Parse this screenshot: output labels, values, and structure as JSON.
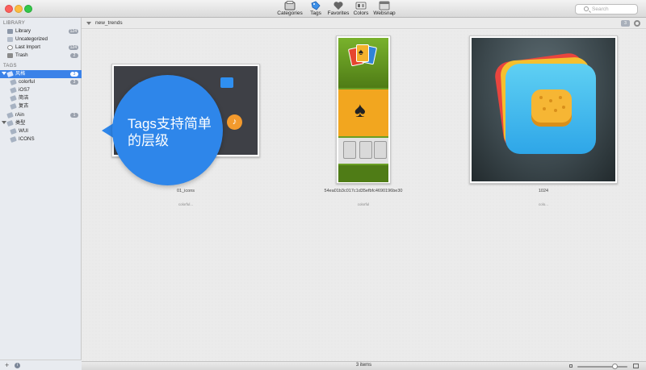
{
  "toolbar": {
    "buttons": [
      {
        "label": "Categories",
        "icon": "categories-icon"
      },
      {
        "label": "Tags",
        "icon": "tag-icon"
      },
      {
        "label": "Favorites",
        "icon": "heart-icon"
      },
      {
        "label": "Colors",
        "icon": "colors-icon"
      },
      {
        "label": "Websnap",
        "icon": "websnap-icon"
      }
    ],
    "search_placeholder": "Search"
  },
  "sidebar": {
    "library_header": "LIBRARY",
    "library_items": [
      {
        "label": "Library",
        "count": "124"
      },
      {
        "label": "Uncategorized",
        "count": ""
      },
      {
        "label": "Last Import",
        "count": "124"
      },
      {
        "label": "Trash",
        "count": "2"
      }
    ],
    "tags_header": "TAGS",
    "tag_items": [
      {
        "label": "风格",
        "count": "3"
      },
      {
        "label": "colorful",
        "count": "3"
      },
      {
        "label": "iOS7",
        "count": ""
      },
      {
        "label": "简洁",
        "count": ""
      },
      {
        "label": "复古",
        "count": ""
      },
      {
        "label": "rAin",
        "count": "1"
      },
      {
        "label": "类型",
        "count": ""
      },
      {
        "label": "WUI",
        "count": ""
      },
      {
        "label": "ICONS",
        "count": ""
      }
    ]
  },
  "pathbar": {
    "name": "new_trends",
    "count": "3"
  },
  "items": [
    {
      "caption": "01_icons",
      "sub": "colorful..."
    },
    {
      "caption": "54ea01b3c017c1d35efbfc4690196be30",
      "sub": "colorful"
    },
    {
      "caption": "1024",
      "sub": "colo..."
    }
  ],
  "overlay": {
    "text": "Tags支持简单的层级"
  },
  "status": {
    "items": "3 items"
  },
  "colors": {
    "accent": "#3b82e8",
    "bubble": "#2e86ea"
  }
}
